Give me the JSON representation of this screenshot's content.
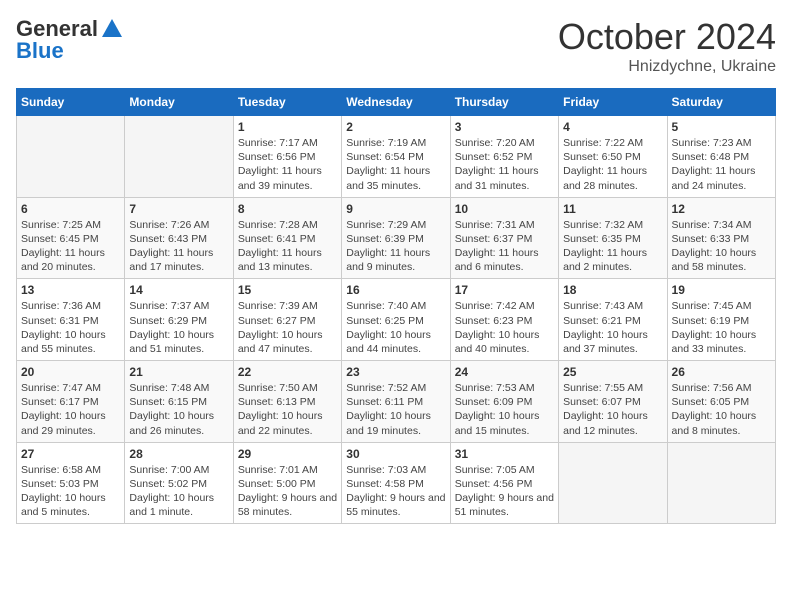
{
  "logo": {
    "general": "General",
    "blue": "Blue"
  },
  "title": {
    "month": "October 2024",
    "location": "Hnizdychne, Ukraine"
  },
  "days_header": [
    "Sunday",
    "Monday",
    "Tuesday",
    "Wednesday",
    "Thursday",
    "Friday",
    "Saturday"
  ],
  "weeks": [
    [
      {
        "num": "",
        "empty": true
      },
      {
        "num": "",
        "empty": true
      },
      {
        "num": "1",
        "sunrise": "Sunrise: 7:17 AM",
        "sunset": "Sunset: 6:56 PM",
        "daylight": "Daylight: 11 hours and 39 minutes."
      },
      {
        "num": "2",
        "sunrise": "Sunrise: 7:19 AM",
        "sunset": "Sunset: 6:54 PM",
        "daylight": "Daylight: 11 hours and 35 minutes."
      },
      {
        "num": "3",
        "sunrise": "Sunrise: 7:20 AM",
        "sunset": "Sunset: 6:52 PM",
        "daylight": "Daylight: 11 hours and 31 minutes."
      },
      {
        "num": "4",
        "sunrise": "Sunrise: 7:22 AM",
        "sunset": "Sunset: 6:50 PM",
        "daylight": "Daylight: 11 hours and 28 minutes."
      },
      {
        "num": "5",
        "sunrise": "Sunrise: 7:23 AM",
        "sunset": "Sunset: 6:48 PM",
        "daylight": "Daylight: 11 hours and 24 minutes."
      }
    ],
    [
      {
        "num": "6",
        "sunrise": "Sunrise: 7:25 AM",
        "sunset": "Sunset: 6:45 PM",
        "daylight": "Daylight: 11 hours and 20 minutes."
      },
      {
        "num": "7",
        "sunrise": "Sunrise: 7:26 AM",
        "sunset": "Sunset: 6:43 PM",
        "daylight": "Daylight: 11 hours and 17 minutes."
      },
      {
        "num": "8",
        "sunrise": "Sunrise: 7:28 AM",
        "sunset": "Sunset: 6:41 PM",
        "daylight": "Daylight: 11 hours and 13 minutes."
      },
      {
        "num": "9",
        "sunrise": "Sunrise: 7:29 AM",
        "sunset": "Sunset: 6:39 PM",
        "daylight": "Daylight: 11 hours and 9 minutes."
      },
      {
        "num": "10",
        "sunrise": "Sunrise: 7:31 AM",
        "sunset": "Sunset: 6:37 PM",
        "daylight": "Daylight: 11 hours and 6 minutes."
      },
      {
        "num": "11",
        "sunrise": "Sunrise: 7:32 AM",
        "sunset": "Sunset: 6:35 PM",
        "daylight": "Daylight: 11 hours and 2 minutes."
      },
      {
        "num": "12",
        "sunrise": "Sunrise: 7:34 AM",
        "sunset": "Sunset: 6:33 PM",
        "daylight": "Daylight: 10 hours and 58 minutes."
      }
    ],
    [
      {
        "num": "13",
        "sunrise": "Sunrise: 7:36 AM",
        "sunset": "Sunset: 6:31 PM",
        "daylight": "Daylight: 10 hours and 55 minutes."
      },
      {
        "num": "14",
        "sunrise": "Sunrise: 7:37 AM",
        "sunset": "Sunset: 6:29 PM",
        "daylight": "Daylight: 10 hours and 51 minutes."
      },
      {
        "num": "15",
        "sunrise": "Sunrise: 7:39 AM",
        "sunset": "Sunset: 6:27 PM",
        "daylight": "Daylight: 10 hours and 47 minutes."
      },
      {
        "num": "16",
        "sunrise": "Sunrise: 7:40 AM",
        "sunset": "Sunset: 6:25 PM",
        "daylight": "Daylight: 10 hours and 44 minutes."
      },
      {
        "num": "17",
        "sunrise": "Sunrise: 7:42 AM",
        "sunset": "Sunset: 6:23 PM",
        "daylight": "Daylight: 10 hours and 40 minutes."
      },
      {
        "num": "18",
        "sunrise": "Sunrise: 7:43 AM",
        "sunset": "Sunset: 6:21 PM",
        "daylight": "Daylight: 10 hours and 37 minutes."
      },
      {
        "num": "19",
        "sunrise": "Sunrise: 7:45 AM",
        "sunset": "Sunset: 6:19 PM",
        "daylight": "Daylight: 10 hours and 33 minutes."
      }
    ],
    [
      {
        "num": "20",
        "sunrise": "Sunrise: 7:47 AM",
        "sunset": "Sunset: 6:17 PM",
        "daylight": "Daylight: 10 hours and 29 minutes."
      },
      {
        "num": "21",
        "sunrise": "Sunrise: 7:48 AM",
        "sunset": "Sunset: 6:15 PM",
        "daylight": "Daylight: 10 hours and 26 minutes."
      },
      {
        "num": "22",
        "sunrise": "Sunrise: 7:50 AM",
        "sunset": "Sunset: 6:13 PM",
        "daylight": "Daylight: 10 hours and 22 minutes."
      },
      {
        "num": "23",
        "sunrise": "Sunrise: 7:52 AM",
        "sunset": "Sunset: 6:11 PM",
        "daylight": "Daylight: 10 hours and 19 minutes."
      },
      {
        "num": "24",
        "sunrise": "Sunrise: 7:53 AM",
        "sunset": "Sunset: 6:09 PM",
        "daylight": "Daylight: 10 hours and 15 minutes."
      },
      {
        "num": "25",
        "sunrise": "Sunrise: 7:55 AM",
        "sunset": "Sunset: 6:07 PM",
        "daylight": "Daylight: 10 hours and 12 minutes."
      },
      {
        "num": "26",
        "sunrise": "Sunrise: 7:56 AM",
        "sunset": "Sunset: 6:05 PM",
        "daylight": "Daylight: 10 hours and 8 minutes."
      }
    ],
    [
      {
        "num": "27",
        "sunrise": "Sunrise: 6:58 AM",
        "sunset": "Sunset: 5:03 PM",
        "daylight": "Daylight: 10 hours and 5 minutes."
      },
      {
        "num": "28",
        "sunrise": "Sunrise: 7:00 AM",
        "sunset": "Sunset: 5:02 PM",
        "daylight": "Daylight: 10 hours and 1 minute."
      },
      {
        "num": "29",
        "sunrise": "Sunrise: 7:01 AM",
        "sunset": "Sunset: 5:00 PM",
        "daylight": "Daylight: 9 hours and 58 minutes."
      },
      {
        "num": "30",
        "sunrise": "Sunrise: 7:03 AM",
        "sunset": "Sunset: 4:58 PM",
        "daylight": "Daylight: 9 hours and 55 minutes."
      },
      {
        "num": "31",
        "sunrise": "Sunrise: 7:05 AM",
        "sunset": "Sunset: 4:56 PM",
        "daylight": "Daylight: 9 hours and 51 minutes."
      },
      {
        "num": "",
        "empty": true
      },
      {
        "num": "",
        "empty": true
      }
    ]
  ]
}
